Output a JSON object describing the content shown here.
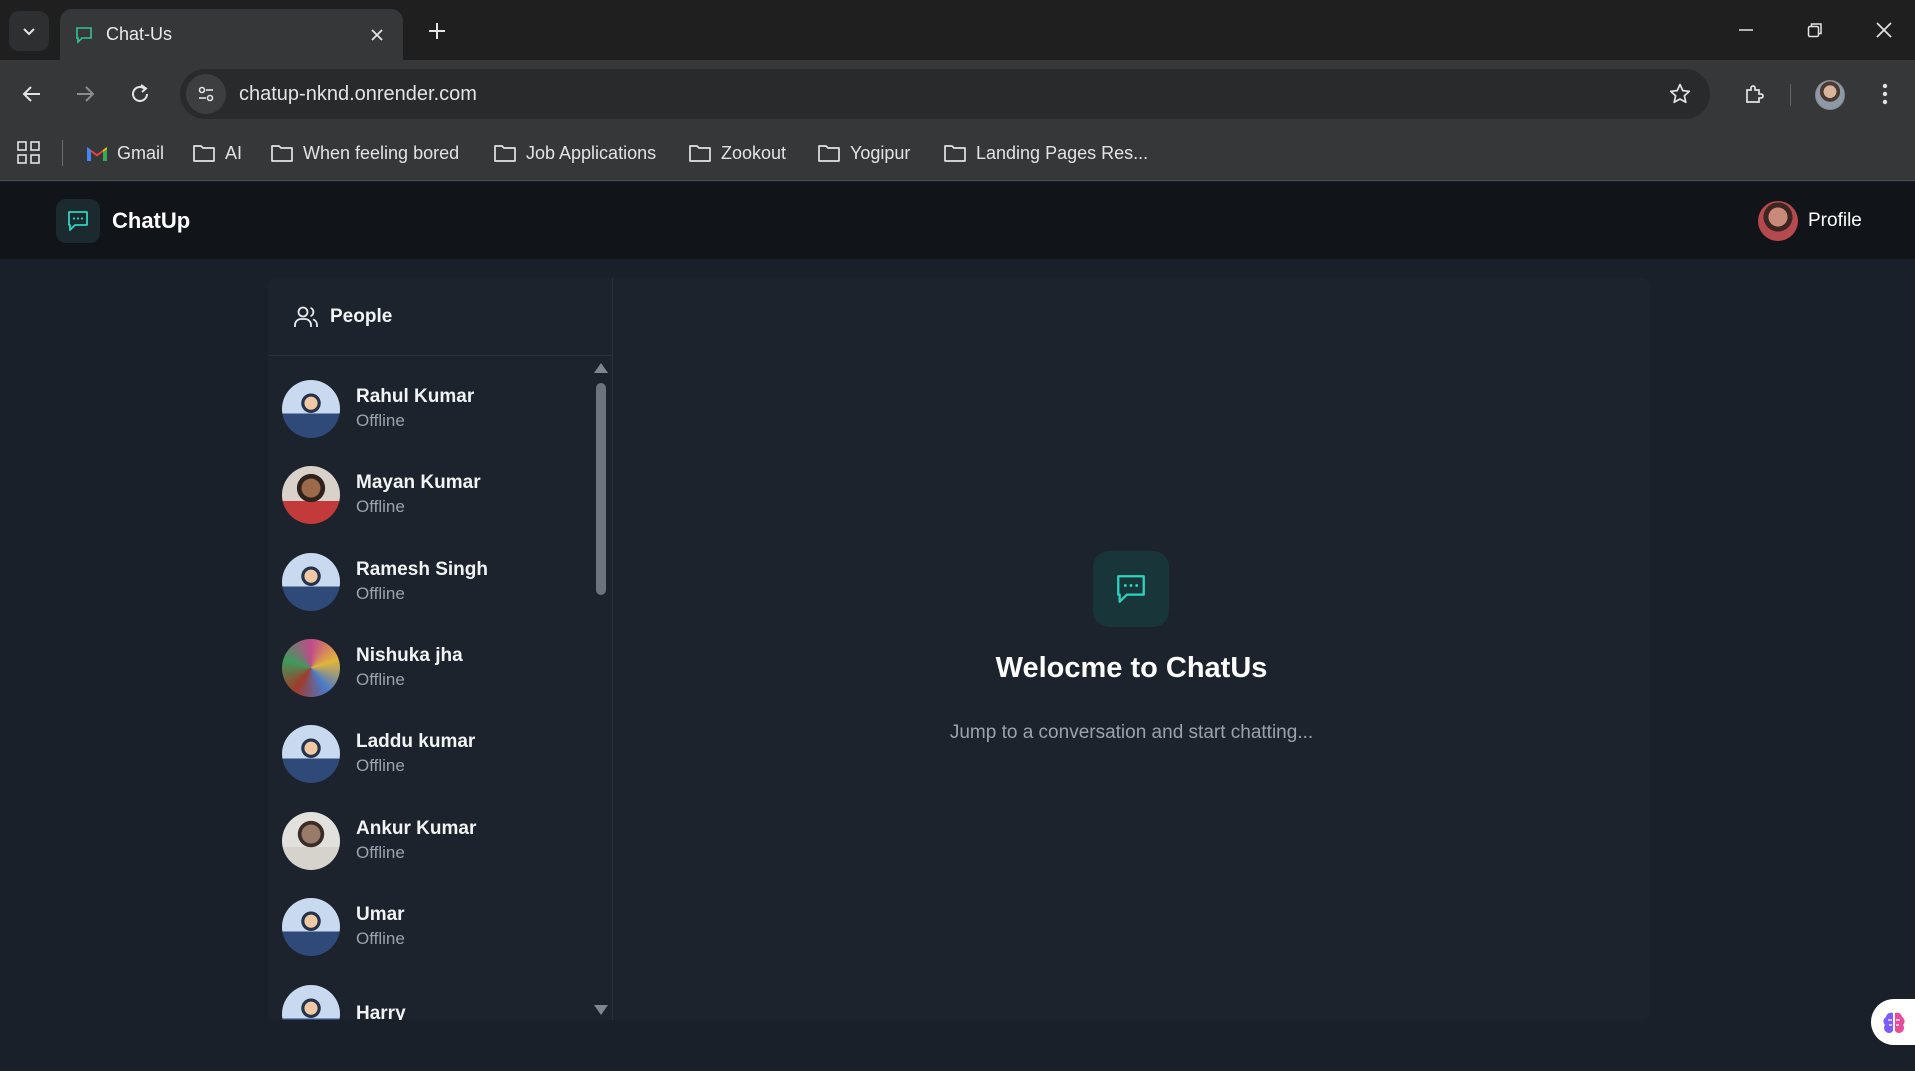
{
  "browser": {
    "tab_title": "Chat-Us",
    "url": "chatup-nknd.onrender.com",
    "icons": {
      "tab_search": "chevron-down-icon",
      "tab_close": "close-icon",
      "new_tab": "plus-icon",
      "back": "back-arrow-icon",
      "forward": "forward-arrow-icon",
      "reload": "reload-icon",
      "site_info": "site-info-icon",
      "bookmark_star": "star-icon",
      "extensions": "puzzle-icon",
      "menu": "kebab-menu-icon",
      "minimize": "minimize-icon",
      "restore": "restore-icon",
      "close": "close-icon"
    },
    "bookmarks": [
      {
        "label": "Gmail",
        "icon": "gmail-icon"
      },
      {
        "label": "AI",
        "icon": "folder-icon"
      },
      {
        "label": "When feeling bored",
        "icon": "folder-icon"
      },
      {
        "label": "Job Applications",
        "icon": "folder-icon"
      },
      {
        "label": "Zookout",
        "icon": "folder-icon"
      },
      {
        "label": "Yogipur",
        "icon": "folder-icon"
      },
      {
        "label": "Landing Pages Res...",
        "icon": "folder-icon"
      }
    ]
  },
  "app": {
    "brand": "ChatUp",
    "profile_label": "Profile",
    "accent_color": "#2dd4bf",
    "sidebar": {
      "title": "People",
      "people": [
        {
          "name": "Rahul Kumar",
          "status": "Offline"
        },
        {
          "name": "Mayan Kumar",
          "status": "Offline"
        },
        {
          "name": "Ramesh Singh",
          "status": "Offline"
        },
        {
          "name": "Nishuka jha",
          "status": "Offline"
        },
        {
          "name": "Laddu kumar",
          "status": "Offline"
        },
        {
          "name": "Ankur Kumar",
          "status": "Offline"
        },
        {
          "name": "Umar",
          "status": "Offline"
        },
        {
          "name": "Harry",
          "status": ""
        }
      ]
    },
    "welcome": {
      "title": "Welocme to ChatUs",
      "subtitle": "Jump to a conversation and start chatting..."
    }
  }
}
